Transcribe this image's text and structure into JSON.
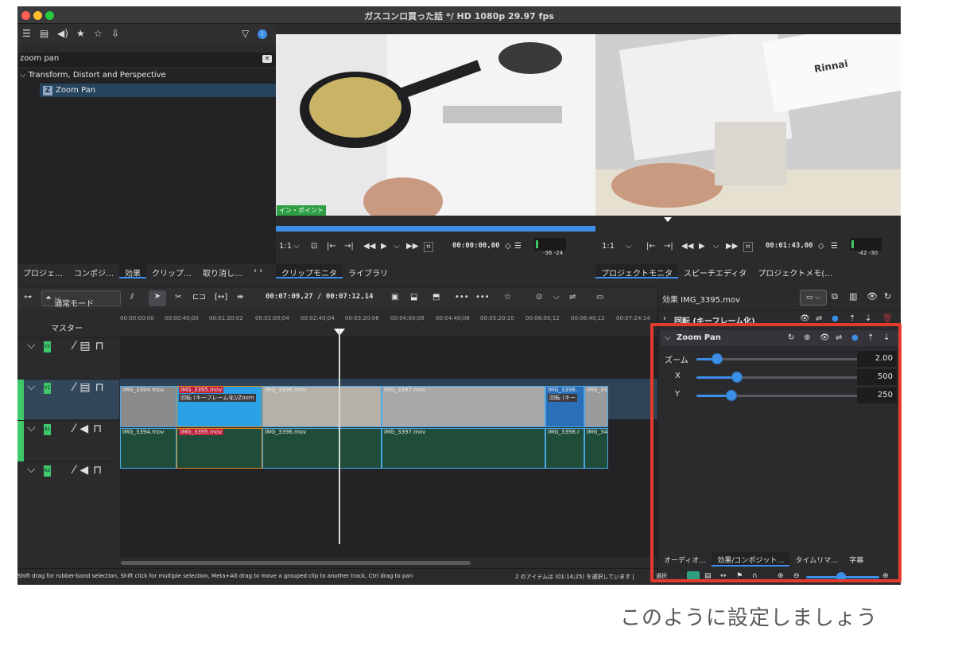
{
  "window_title": "ガスコンロ買った話 */ HD 1080p 29.97 fps",
  "effects_panel": {
    "search_value": "zoom pan",
    "category": "Transform, Distort and Perspective",
    "item": "Zoom Pan",
    "item_badge": "Z"
  },
  "left_tabs": [
    "プロジェ…",
    "コンポジ…",
    "効果",
    "クリップ…",
    "取り消し…"
  ],
  "clip_monitor": {
    "in_point_label": "イン・ポイント",
    "zoom": "1:1",
    "timecode": "00:00:00,00",
    "meter_scale": "-36 -24",
    "tabs": [
      "クリップモニタ",
      "ライブラリ"
    ]
  },
  "project_monitor": {
    "zoom": "1:1",
    "timecode": "00:01:43,00",
    "meter_scale": "-42 -30",
    "tabs": [
      "プロジェクトモニタ",
      "スピーチエディタ",
      "プロジェクトメモ(…"
    ]
  },
  "timeline_toolbar": {
    "mode": "通常モード",
    "position": "00:07:09,27 / 00:07:12,14"
  },
  "tracks": {
    "master_label": "マスター",
    "labels": [
      "V2",
      "V1",
      "A1",
      "A2"
    ],
    "ruler": [
      "00:00:00;00",
      "00:00:40;00",
      "00:01:20;02",
      "00:02:00;04",
      "00:02:40;04",
      "00:03:20;06",
      "00:04:00;08",
      "00:04:40;08",
      "00:05:20;10",
      "00:06:00;12",
      "00:06:40;12",
      "00:07:24;14"
    ],
    "video_clips": [
      {
        "name": "IMG_3394.mov"
      },
      {
        "name": "IMG_3395.mov",
        "effect": "回転 (キーフレーム化)/Zoom"
      },
      {
        "name": "IMG_3396.mov"
      },
      {
        "name": "IMG_3397.mov"
      },
      {
        "name": "IMG_3398.",
        "effect": "回転 (キー"
      },
      {
        "name": "IMG_34"
      }
    ],
    "audio_clips": [
      "IMG_3394.mov",
      "IMG_3395.mov",
      "IMG_3396.mov",
      "IMG_3397.mov",
      "IMG_3398.r",
      "IMG_34"
    ]
  },
  "status": {
    "hint": "Shift drag for rubber-band selection, Shift click for multiple selection, Meta+Alt drag to move a grouped clip to another track, Ctrl drag to pan",
    "selection": "2 のアイテムは (01:14;25) を選択しています |",
    "select_label": "選択"
  },
  "effect_stack": {
    "header": "効果 IMG_3395.mov",
    "rotate_effect": "回転 (キーフレーム化)",
    "zoom_pan": "Zoom Pan",
    "params": [
      {
        "label": "ズーム",
        "value": "2.00",
        "level": 0.12
      },
      {
        "label": "X",
        "value": "500",
        "level": 0.23
      },
      {
        "label": "Y",
        "value": "250",
        "level": 0.2
      }
    ],
    "bottom_tabs": [
      "オーディオ…",
      "効果/コンポジット…",
      "タイムリマ…",
      "字幕"
    ]
  },
  "caption": "このように設定しましょう",
  "colors": {
    "accent": "#3d8ee6",
    "highlight_box": "#e23b2e",
    "track_green": "#3ec86a",
    "audio_clip": "#1f4d3a"
  }
}
